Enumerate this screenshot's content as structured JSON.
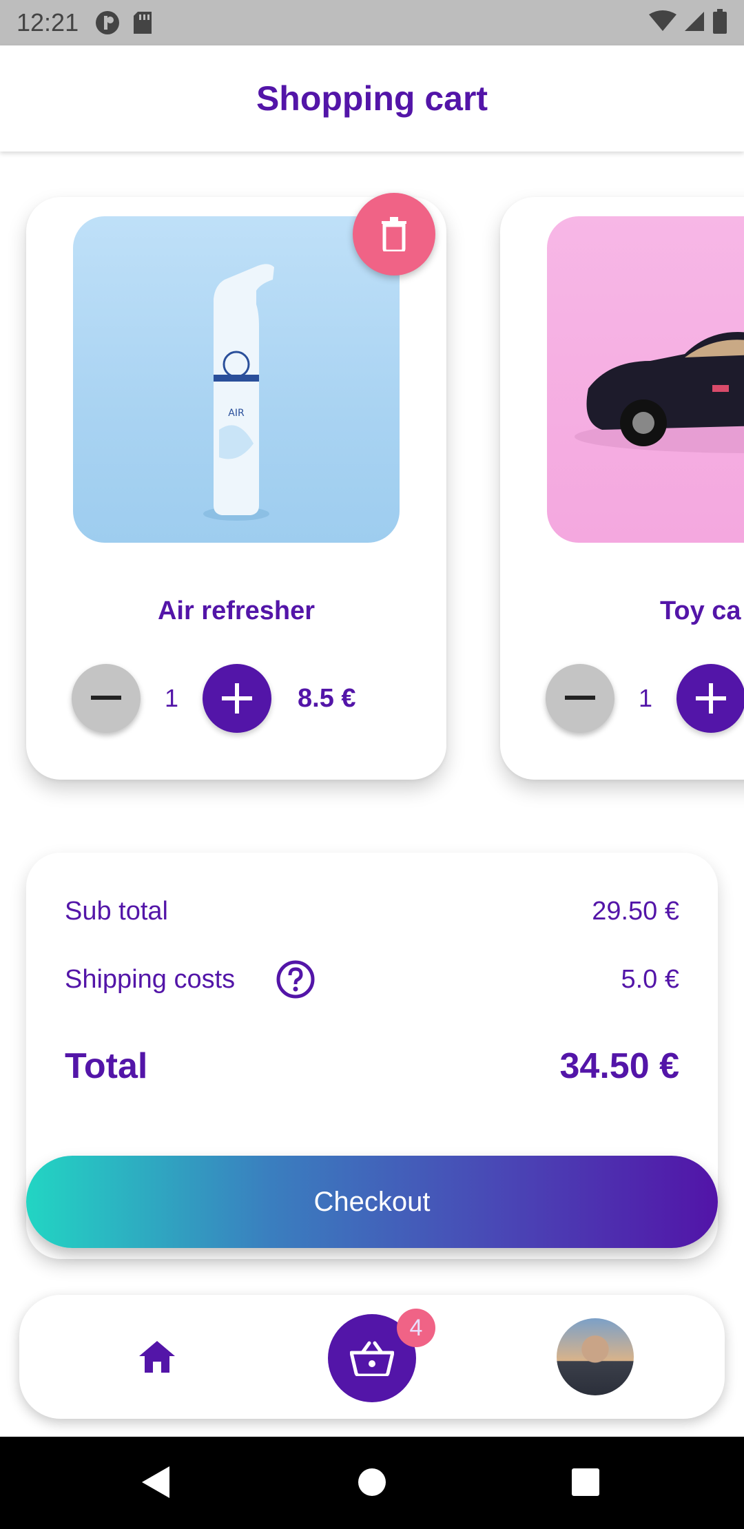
{
  "status_bar": {
    "time": "12:21"
  },
  "app_bar": {
    "title": "Shopping cart"
  },
  "cart_items": [
    {
      "name": "Air refresher",
      "quantity": "1",
      "price": "8.5 €",
      "image": "air-freshener-bottle"
    },
    {
      "name": "Toy ca",
      "quantity": "1",
      "image": "toy-car"
    }
  ],
  "summary": {
    "subtotal_label": "Sub total",
    "subtotal_value": "29.50 €",
    "shipping_label": "Shipping costs",
    "shipping_value": "5.0 €",
    "total_label": "Total",
    "total_value": "34.50 €"
  },
  "checkout": {
    "label": "Checkout"
  },
  "bottom_nav": {
    "cart_badge": "4"
  },
  "colors": {
    "primary": "#5315a8",
    "accent_pink": "#f06386",
    "gradient_start": "#22d5c3",
    "gradient_end": "#5214a8"
  }
}
